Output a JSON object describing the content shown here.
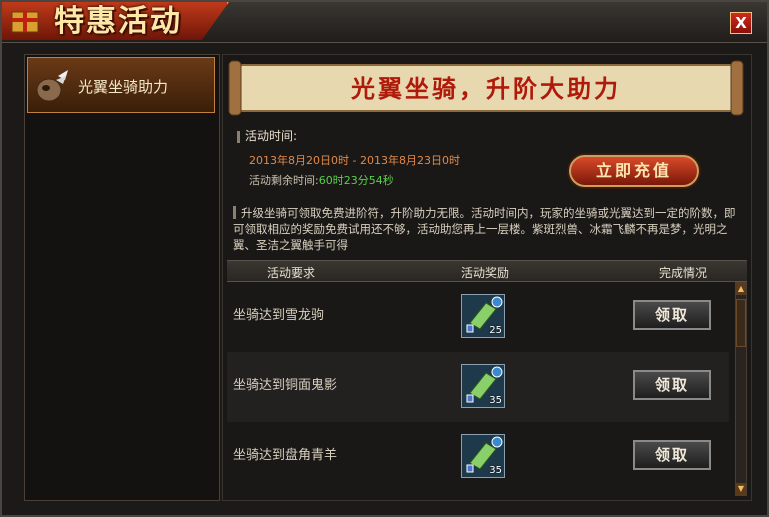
{
  "window": {
    "title": "特惠活动",
    "close_label": "X"
  },
  "sidebar": {
    "items": [
      {
        "label": "光翼坐骑助力",
        "icon": "horse-icon"
      }
    ]
  },
  "banner": {
    "text": "光翼坐骑，升阶大助力"
  },
  "info": {
    "time_heading": "活动时间:",
    "time_range": "2013年8月20日0时 - 2013年8月23日0时",
    "remaining_label": "活动剩余时间:",
    "remaining_value": "60时23分54秒"
  },
  "recharge_button": {
    "label": "立即充值"
  },
  "description": "升级坐骑可领取免费进阶符，升阶助力无限。活动时间内，玩家的坐骑或光翼达到一定的阶数，即可领取相应的奖励免费试用还不够，活动助您再上一层楼。紫斑烈兽、冰霜飞麟不再是梦，光明之翼、圣洁之翼触手可得",
  "table": {
    "headers": [
      "活动要求",
      "活动奖励",
      "完成情况"
    ],
    "rows": [
      {
        "requirement": "坐骑达到雪龙驹",
        "reward_count": "25",
        "button": "领取"
      },
      {
        "requirement": "坐骑达到铜面鬼影",
        "reward_count": "35",
        "button": "领取"
      },
      {
        "requirement": "坐骑达到盘角青羊",
        "reward_count": "35",
        "button": "领取"
      }
    ]
  },
  "colors": {
    "accent_red": "#b01a0a",
    "remaining_green": "#5ad04a",
    "date_orange": "#e08a4a"
  }
}
